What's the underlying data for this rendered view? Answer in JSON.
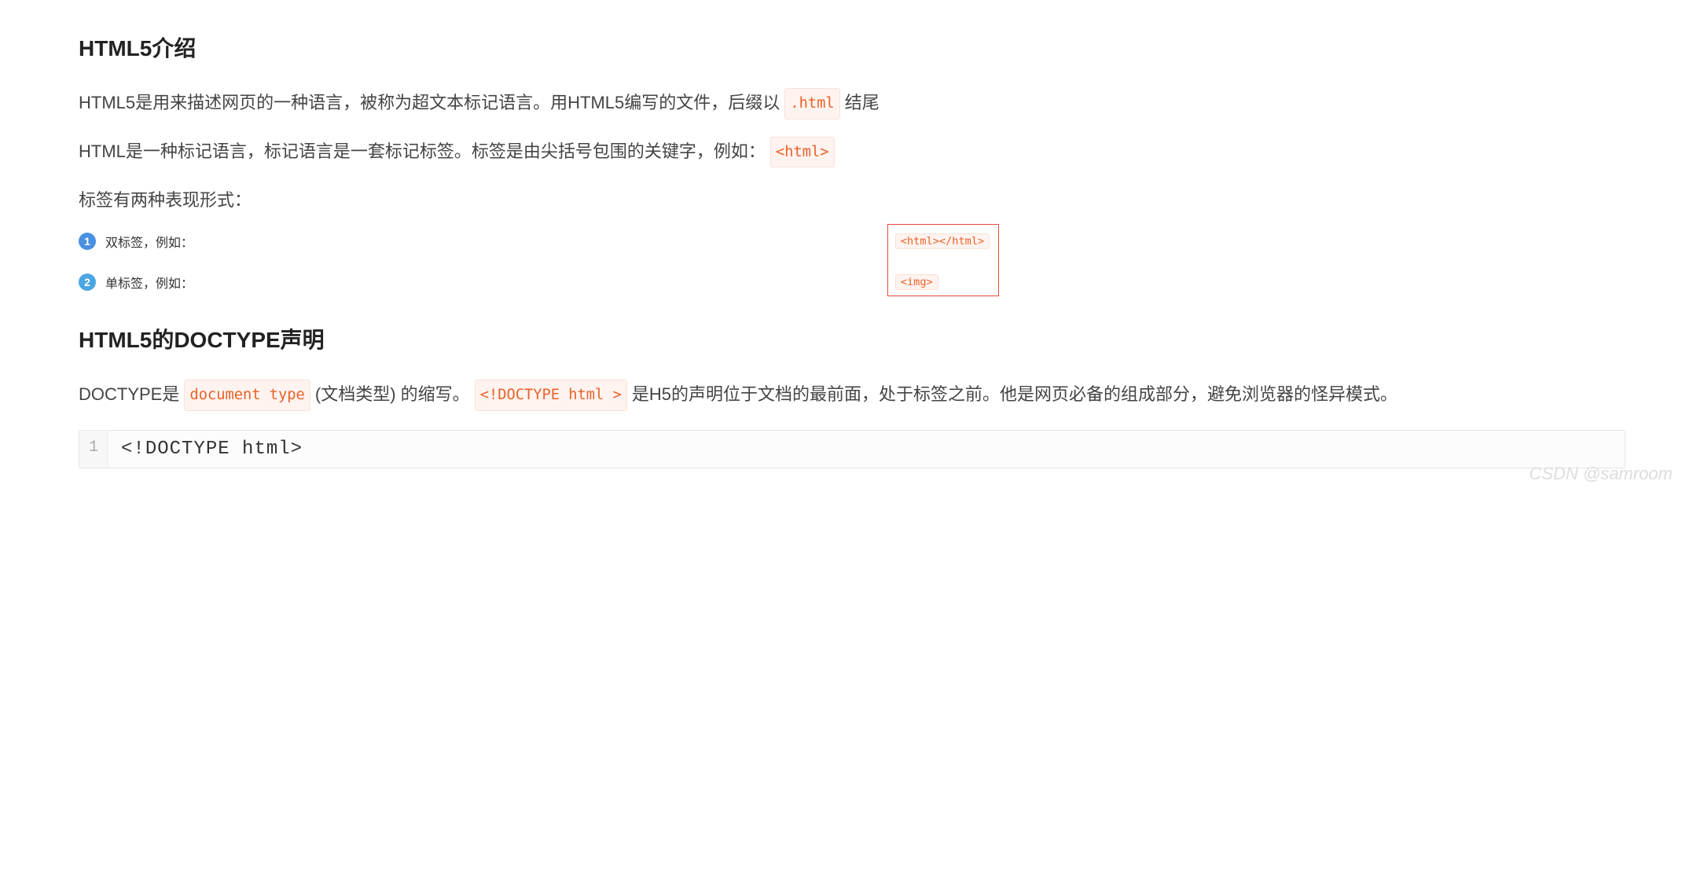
{
  "section1": {
    "heading": "HTML5介绍",
    "p1_a": "HTML5是用来描述网页的一种语言，被称为超文本标记语言。用HTML5编写的文件，后缀以",
    "p1_code": ".html",
    "p1_b": "结尾",
    "p2_a": "HTML是一种标记语言，标记语言是一套标记标签。标签是由尖括号包围的关键字，例如：",
    "p2_code": "<html>",
    "p3": "标签有两种表现形式：",
    "list": {
      "i1": {
        "num": "1",
        "label": "双标签，例如：",
        "code": "<html></html>"
      },
      "i2": {
        "num": "2",
        "label": "单标签，例如：",
        "code": "<img>"
      }
    }
  },
  "section2": {
    "heading": "HTML5的DOCTYPE声明",
    "p1_a": "DOCTYPE是",
    "p1_code1": "document type",
    "p1_b": " (文档类型) 的缩写。",
    "p1_code2": "<!DOCTYPE html >",
    "p1_c": "是H5的声明位于文档的最前面，处于标签之前。他是网页必备的组成部分，避免浏览器的怪异模式。",
    "codeblock": {
      "lineNum": "1",
      "code": "<!DOCTYPE html>"
    }
  },
  "watermark": "CSDN @samroom"
}
